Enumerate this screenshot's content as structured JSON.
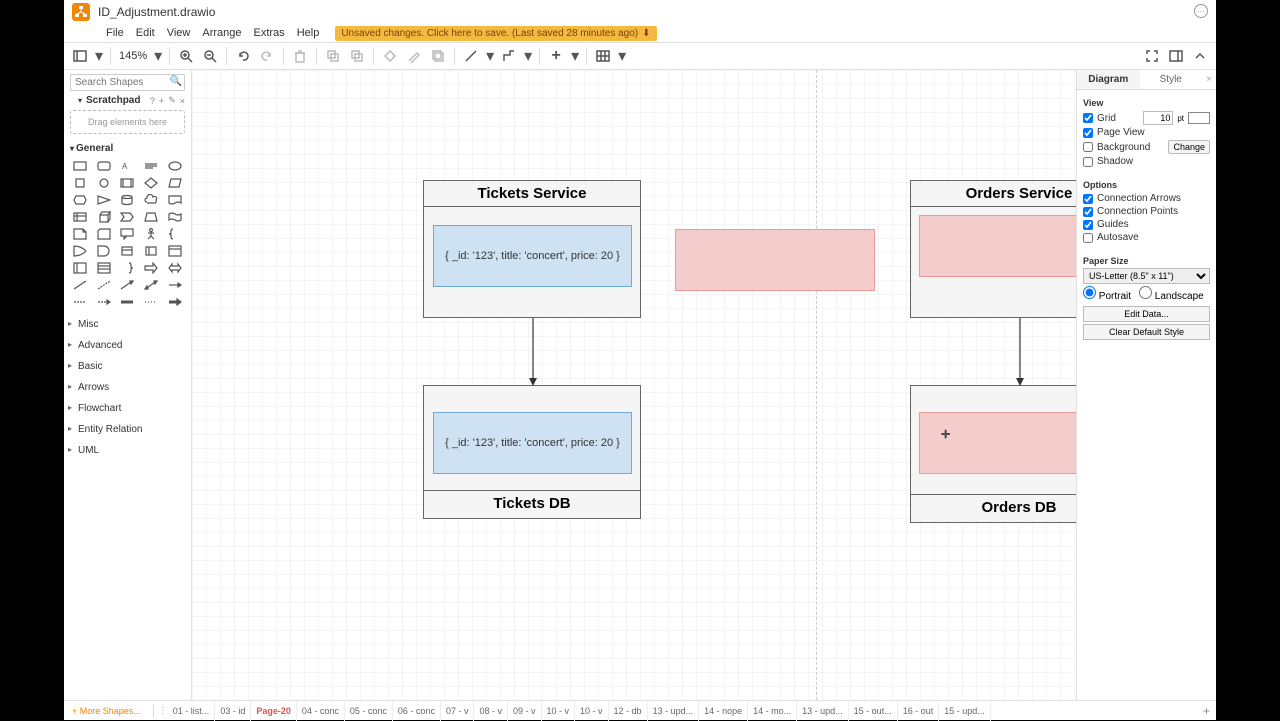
{
  "filename": "ID_Adjustment.drawio",
  "menus": [
    "File",
    "Edit",
    "View",
    "Arrange",
    "Extras",
    "Help"
  ],
  "unsaved_msg": "Unsaved changes. Click here to save. (Last saved 28 minutes ago)",
  "zoom": "145%",
  "search_placeholder": "Search Shapes",
  "scratchpad_label": "Scratchpad",
  "drag_hint": "Drag elements here",
  "general_label": "General",
  "categories": [
    "Misc",
    "Advanced",
    "Basic",
    "Arrows",
    "Flowchart",
    "Entity Relation",
    "UML"
  ],
  "more_shapes": "More Shapes...",
  "right": {
    "tabs": [
      "Diagram",
      "Style"
    ],
    "view_label": "View",
    "grid": "Grid",
    "grid_val": "10",
    "grid_unit": "pt",
    "page_view": "Page View",
    "background": "Background",
    "change": "Change",
    "shadow": "Shadow",
    "options_label": "Options",
    "conn_arrows": "Connection Arrows",
    "conn_points": "Connection Points",
    "guides": "Guides",
    "autosave": "Autosave",
    "paper_label": "Paper Size",
    "paper_sel": "US-Letter (8.5\" x 11\")",
    "portrait": "Portrait",
    "landscape": "Landscape",
    "edit_data": "Edit Data...",
    "clear_style": "Clear Default Style"
  },
  "diagram": {
    "tickets_service": "Tickets Service",
    "tickets_db": "Tickets DB",
    "orders_service": "Orders Service",
    "orders_db": "Orders DB",
    "ticket_json": "{ _id: '123', title: 'concert', price: 20 }"
  },
  "pages": [
    "01 - list...",
    "03 - id",
    "Page-20",
    "04 - conc",
    "05 - conc",
    "06 - conc",
    "07 - v",
    "08 - v",
    "09 - v",
    "10 - v",
    "10 - v",
    "12 - db",
    "13 - upd...",
    "14 - nope",
    "14 - mo...",
    "13 - upd...",
    "15 - out...",
    "16 - out",
    "15 - upd..."
  ],
  "active_page_index": 2
}
